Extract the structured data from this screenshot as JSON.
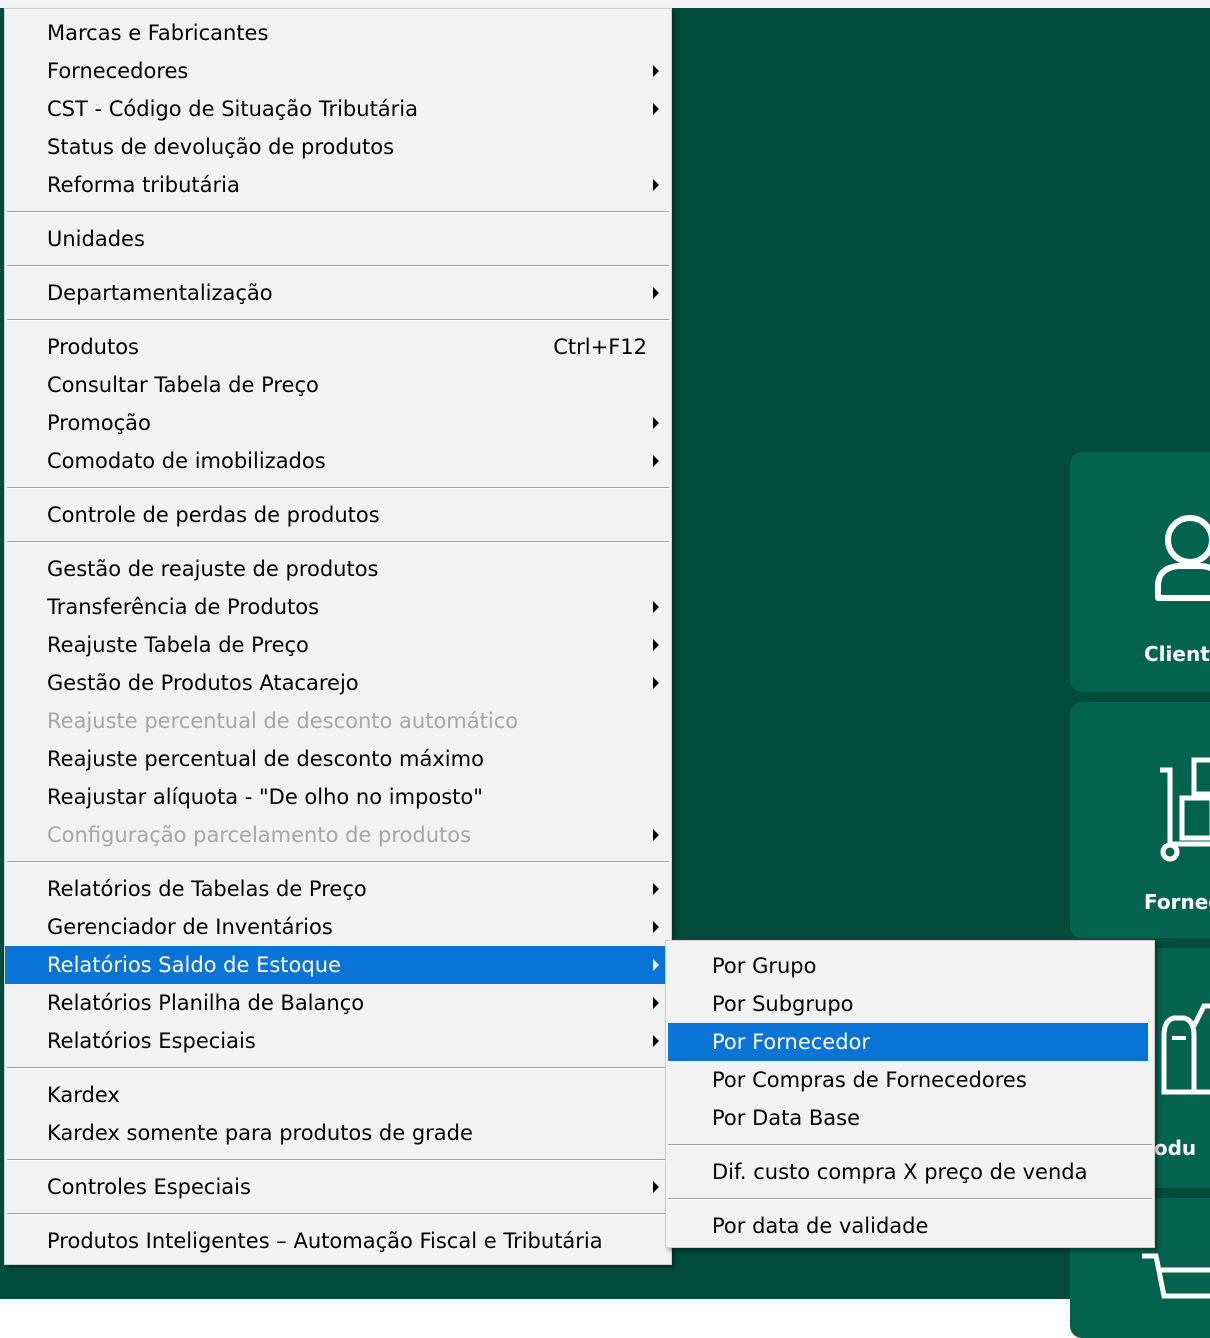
{
  "main_menu": {
    "items": [
      {
        "label": "Marcas e Fabricantes"
      },
      {
        "label": "Fornecedores",
        "submenu": true
      },
      {
        "label": "CST - Código de Situação Tributária",
        "submenu": true
      },
      {
        "label": "Status de devolução de produtos"
      },
      {
        "label": "Reforma tributária",
        "submenu": true
      },
      {
        "label": "Unidades"
      },
      {
        "label": "Departamentalização",
        "submenu": true
      },
      {
        "label": "Produtos",
        "shortcut": "Ctrl+F12"
      },
      {
        "label": "Consultar Tabela de Preço"
      },
      {
        "label": "Promoção",
        "submenu": true
      },
      {
        "label": "Comodato de imobilizados",
        "submenu": true
      },
      {
        "label": "Controle de perdas de produtos"
      },
      {
        "label": "Gestão de reajuste de produtos"
      },
      {
        "label": "Transferência de Produtos",
        "submenu": true
      },
      {
        "label": "Reajuste Tabela de Preço",
        "submenu": true
      },
      {
        "label": "Gestão de Produtos Atacarejo",
        "submenu": true
      },
      {
        "label": "Reajuste percentual de desconto automático",
        "disabled": true
      },
      {
        "label": "Reajuste percentual de desconto máximo"
      },
      {
        "label": "Reajustar alíquota - \"De olho no imposto\""
      },
      {
        "label": "Configuração parcelamento de produtos",
        "disabled": true,
        "submenu": true
      },
      {
        "label": "Relatórios de Tabelas de Preço",
        "submenu": true
      },
      {
        "label": "Gerenciador de Inventários",
        "submenu": true
      },
      {
        "label": "Relatórios Saldo de Estoque",
        "submenu": true,
        "highlighted": true
      },
      {
        "label": "Relatórios Planilha de Balanço",
        "submenu": true
      },
      {
        "label": "Relatórios Especiais",
        "submenu": true
      },
      {
        "label": "Kardex"
      },
      {
        "label": "Kardex somente para produtos de grade"
      },
      {
        "label": "Controles Especiais",
        "submenu": true
      },
      {
        "label": "Produtos Inteligentes – Automação Fiscal e Tributária"
      }
    ]
  },
  "sub_menu": {
    "items": [
      {
        "label": "Por Grupo"
      },
      {
        "label": "Por Subgrupo"
      },
      {
        "label": "Por Fornecedor",
        "highlighted": true
      },
      {
        "label": "Por Compras de Fornecedores"
      },
      {
        "label": "Por Data Base"
      },
      {
        "label": "Dif. custo compra X preço de venda"
      },
      {
        "label": "Por data de validade"
      }
    ]
  },
  "tiles": {
    "clientes_label": "Client",
    "fornecedores_label": "Fornec",
    "produtos_label": "rodu"
  },
  "colors": {
    "desktop_bg": "#024c3c",
    "tile_bg": "#03634f",
    "menu_bg": "#f2f2f2",
    "highlight": "#0a73d6",
    "disabled_text": "#a6a6a6"
  }
}
